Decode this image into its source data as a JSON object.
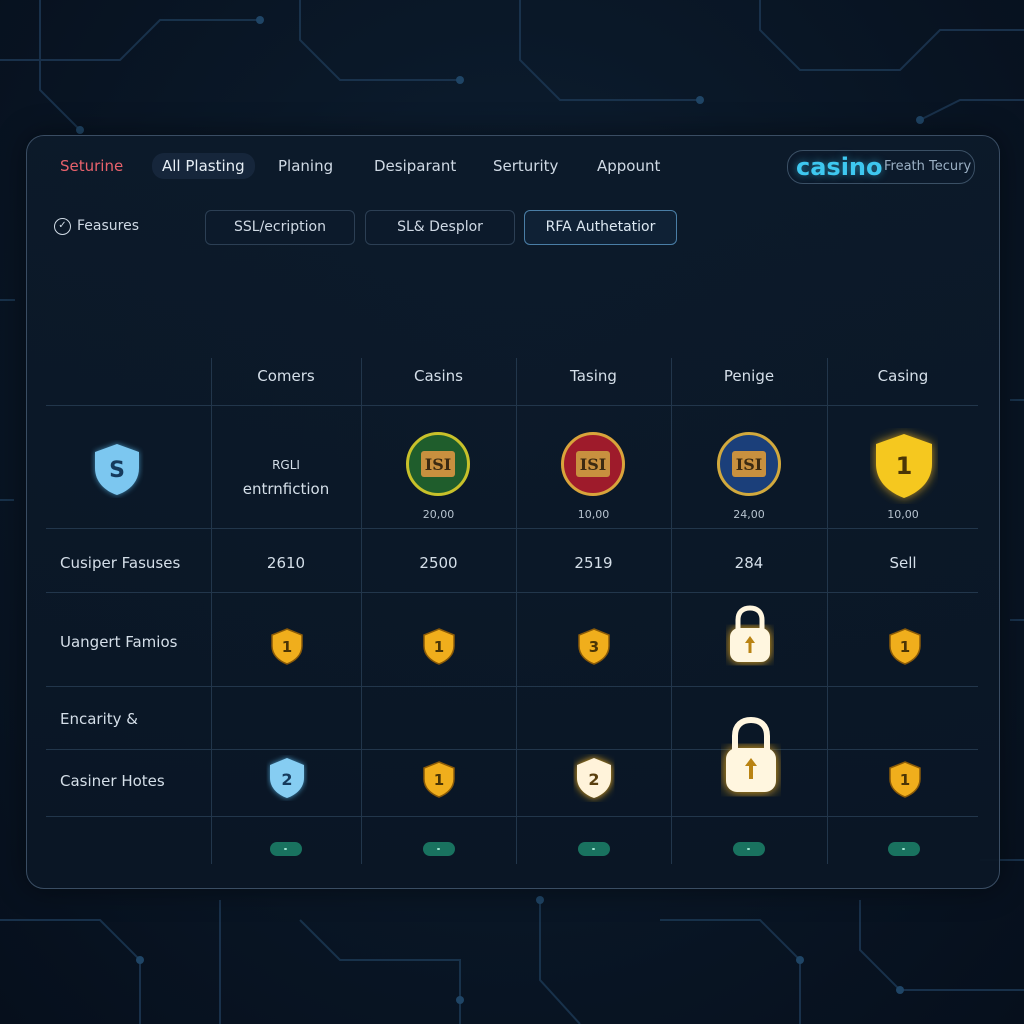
{
  "nav": {
    "items": [
      "Seturine",
      "All Plasting",
      "Planing",
      "Desiparant",
      "Serturity",
      "Appount"
    ],
    "active_index": 0,
    "selected_index": 1
  },
  "brand": {
    "logo": "casino",
    "tagline": "Freath Tecury"
  },
  "features": {
    "label": "Feasures",
    "buttons": [
      "SSL/ecription",
      "SL& Desplor",
      "RFA Authetatior"
    ],
    "highlighted_index": 2
  },
  "table": {
    "columns": [
      "Comers",
      "Casins",
      "Tasing",
      "Penige",
      "Casing"
    ],
    "badge_row": {
      "logo_letter": "S",
      "label_line1": "RGLI",
      "label_line2": "entrnfiction",
      "badges": [
        {
          "text": "ISI",
          "color": "#1f5d2c",
          "ring": "#c8c12a",
          "value": "20,00"
        },
        {
          "text": "ISI",
          "color": "#9e1b2b",
          "ring": "#d9a43b",
          "value": "10,00"
        },
        {
          "text": "ISI",
          "color": "#1b3f7a",
          "ring": "#d2a93d",
          "value": "24,00"
        },
        {
          "text": "1",
          "color": "#f2c21b",
          "ring": "#f2c21b",
          "value": "10,00"
        }
      ]
    },
    "rows": [
      {
        "label": "Cusiper Fasuses",
        "values": [
          "2610",
          "2500",
          "2519",
          "284",
          "Sell"
        ]
      },
      {
        "label": "Uangert Famios",
        "icons": [
          "1",
          "1",
          "3",
          "lock",
          "1"
        ]
      },
      {
        "label": "Encarity &"
      },
      {
        "label": "Casiner Hotes",
        "icons": [
          "2",
          "1",
          "2",
          "lock",
          "1"
        ]
      }
    ]
  },
  "colors": {
    "accent_active": "#e8626c",
    "brand": "#3ec8f0",
    "badge_gold": "#f2b51f",
    "toggle": "#19725f"
  }
}
